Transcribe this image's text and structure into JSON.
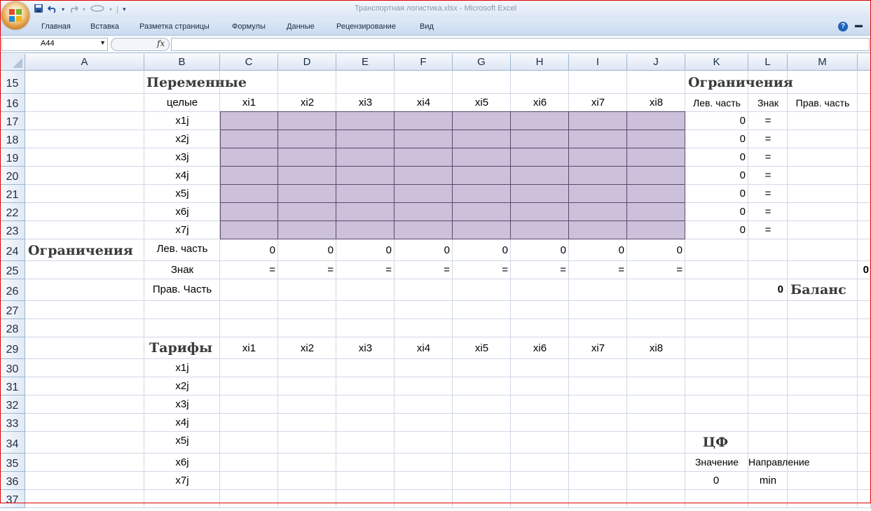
{
  "window": {
    "title": "Транспортная логистика.xlsx - Microsoft Excel"
  },
  "qat": {
    "items": [
      "save-icon",
      "undo-icon",
      "redo-icon",
      "repeat-icon",
      "customize-icon"
    ]
  },
  "ribbon": {
    "tabs": [
      "Главная",
      "Вставка",
      "Разметка страницы",
      "Формулы",
      "Данные",
      "Рецензирование",
      "Вид"
    ]
  },
  "formula_bar": {
    "name_box": "A44",
    "fx": "fx",
    "content": ""
  },
  "columns": [
    "A",
    "B",
    "C",
    "D",
    "E",
    "F",
    "G",
    "H",
    "I",
    "J",
    "K",
    "L",
    "M"
  ],
  "rows": [
    "15",
    "16",
    "17",
    "18",
    "19",
    "20",
    "21",
    "22",
    "23",
    "24",
    "25",
    "26",
    "27",
    "28",
    "29",
    "30",
    "31",
    "32",
    "33",
    "34",
    "35",
    "36",
    "37"
  ],
  "sheet": {
    "variables_title": "Переменные",
    "integers_label": "целые",
    "vars_headers": [
      "xi1",
      "xi2",
      "xi3",
      "xi4",
      "xi5",
      "xi6",
      "xi7",
      "xi8"
    ],
    "row_labels": [
      "x1j",
      "x2j",
      "x3j",
      "x4j",
      "x5j",
      "x6j",
      "x7j"
    ],
    "constraints_right_title": "Ограничения",
    "constraints_right_headers": [
      "Лев. часть",
      "Знак",
      "Прав. часть"
    ],
    "constraints_right_left_values": [
      "0",
      "0",
      "0",
      "0",
      "0",
      "0",
      "0"
    ],
    "constraints_right_signs": [
      "=",
      "=",
      "=",
      "=",
      "=",
      "=",
      "="
    ],
    "constraints_bottom_title": "Ограничения",
    "lhs_label": "Лев. часть",
    "sign_label": "Знак",
    "rhs_label": "Прав. Часть",
    "lhs_values": [
      "0",
      "0",
      "0",
      "0",
      "0",
      "0",
      "0",
      "0"
    ],
    "sign_values": [
      "=",
      "=",
      "=",
      "=",
      "=",
      "=",
      "=",
      "="
    ],
    "m25_value": "0",
    "l26_value": "0",
    "balance_label": "Баланс",
    "tariffs_title": "Тарифы",
    "tariff_headers": [
      "xi1",
      "xi2",
      "xi3",
      "xi4",
      "xi5",
      "xi6",
      "xi7",
      "xi8"
    ],
    "tariff_row_labels": [
      "x1j",
      "x2j",
      "x3j",
      "x4j",
      "x5j",
      "x6j",
      "x7j"
    ],
    "objective_title": "ЦФ",
    "objective_value_label": "Значение",
    "objective_direction_label": "Направление",
    "objective_value": "0",
    "objective_direction": "min"
  }
}
